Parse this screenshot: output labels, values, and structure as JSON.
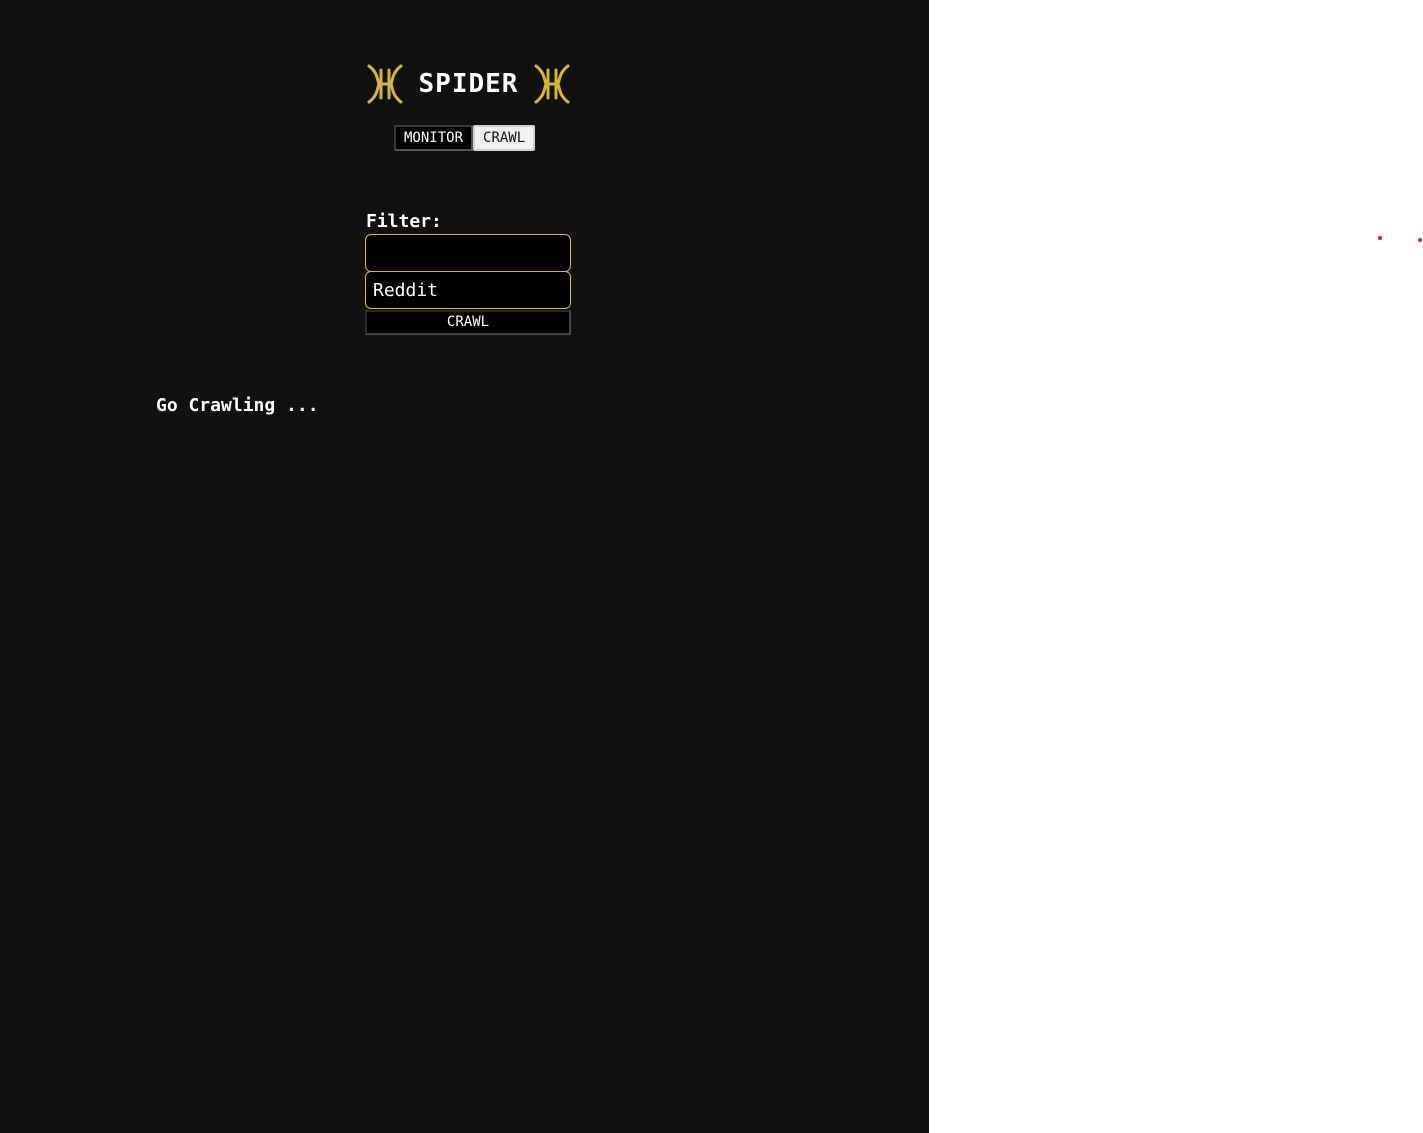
{
  "header": {
    "title": "SPIDER",
    "logo_icon": "spider-icon",
    "logo_color": "#d4b73a"
  },
  "tabs": [
    {
      "label": "MONITOR",
      "active": false
    },
    {
      "label": "CRAWL",
      "active": true
    }
  ],
  "form": {
    "filter_label": "Filter:",
    "filter_value": "",
    "source_value": "Reddit",
    "crawl_button_label": "CRAWL",
    "accent_color": "#d4b73a"
  },
  "status": {
    "text": "Go Crawling ..."
  },
  "colors": {
    "background_dark": "#111111",
    "background_light": "#ffffff",
    "marker_red": "#e01b1b"
  }
}
